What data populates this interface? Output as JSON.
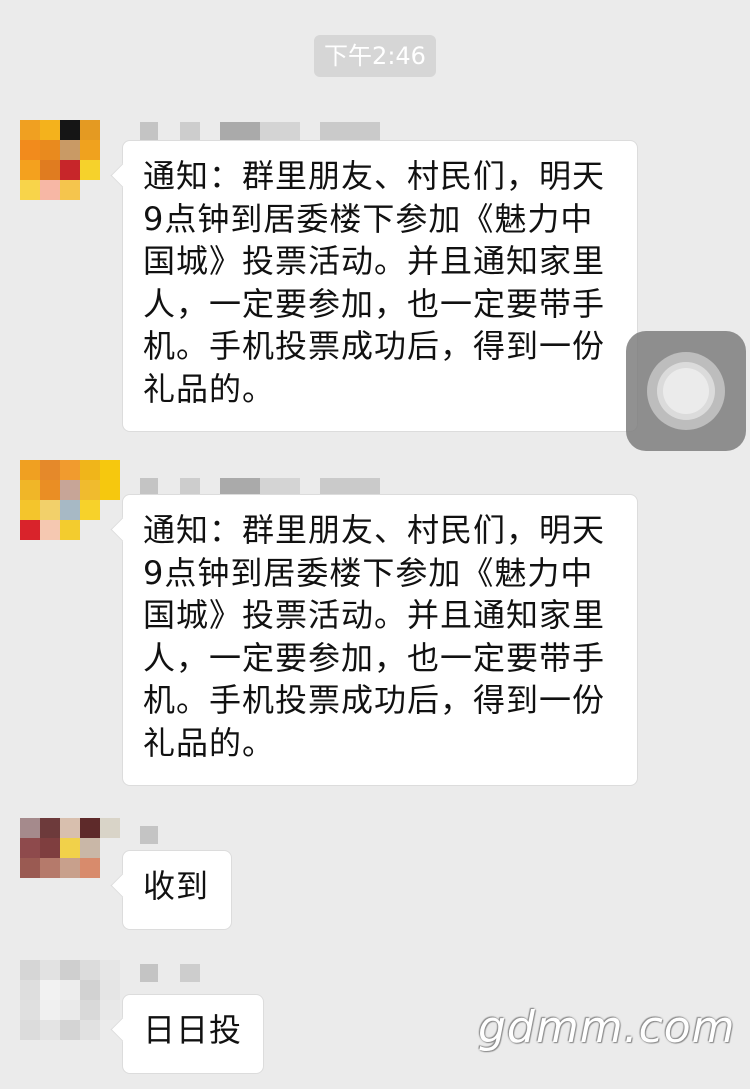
{
  "timestamp": "下午2:46",
  "messages": [
    {
      "lines": [
        "通知：群里朋友、村民们，明天",
        "9点钟到居委楼下参加《魅力中",
        "国城》投票活动。并且通知家里",
        "人，一定要参加，也一定要带手",
        "机。手机投票成功后，得到一份",
        "礼品的。"
      ]
    },
    {
      "lines": [
        "通知：群里朋友、村民们，明天",
        "9点钟到居委楼下参加《魅力中",
        "国城》投票活动。并且通知家里",
        "人，一定要参加，也一定要带手",
        "机。手机投票成功后，得到一份",
        "礼品的。"
      ]
    },
    {
      "text": "收到"
    },
    {
      "text": "日日投"
    }
  ],
  "watermark": "gdmm.com",
  "icons": {
    "assistive_touch": "assistive-touch-icon"
  }
}
